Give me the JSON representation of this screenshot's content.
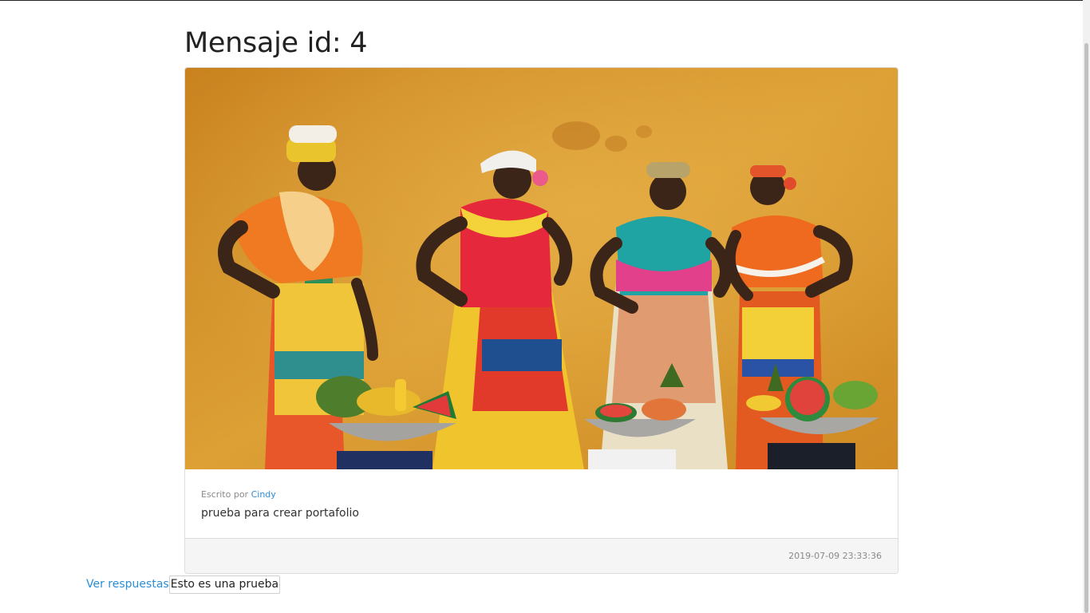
{
  "page": {
    "title": "Mensaje id: 4"
  },
  "message": {
    "image_alt": "Cuatro mujeres con vestidos coloridos y frutas frente a una pared amarilla",
    "written_by_label": "Escrito por",
    "author": "Cindy",
    "text": "prueba para crear portafolio",
    "timestamp": "2019-07-09 23:33:36"
  },
  "replies": {
    "link_label": "Ver respuestas",
    "reply_text": "Esto es una prueba"
  },
  "colors": {
    "link": "#2a8ed6",
    "footer_bg": "#f5f5f5",
    "wall": "#d99a2b"
  }
}
